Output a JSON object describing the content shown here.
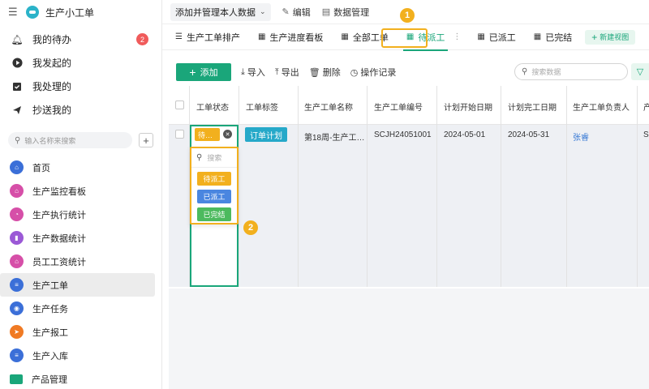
{
  "app": {
    "title": "生产小工单"
  },
  "top_nav": [
    {
      "label": "我的待办",
      "icon": "bell-icon",
      "badge": "2"
    },
    {
      "label": "我发起的",
      "icon": "play-icon"
    },
    {
      "label": "我处理的",
      "icon": "inbox-icon"
    },
    {
      "label": "抄送我的",
      "icon": "send-icon"
    }
  ],
  "sidebar_search": {
    "placeholder": "输入名称来搜索"
  },
  "nav": [
    {
      "label": "首页",
      "icon": "home-icon",
      "color": "#3b6fd8"
    },
    {
      "label": "生产监控看板",
      "icon": "home-icon",
      "color": "#d64fa8"
    },
    {
      "label": "生产执行统计",
      "icon": "pie-chart-icon",
      "color": "#d64fa8"
    },
    {
      "label": "生产数据统计",
      "icon": "bar-chart-icon",
      "color": "#9b59d6"
    },
    {
      "label": "员工工资统计",
      "icon": "home-icon",
      "color": "#d64fa8"
    },
    {
      "label": "生产工单",
      "icon": "document-icon",
      "color": "#3b6fd8"
    },
    {
      "label": "生产任务",
      "icon": "target-icon",
      "color": "#3b6fd8"
    },
    {
      "label": "生产报工",
      "icon": "send-icon",
      "color": "#f07a24"
    },
    {
      "label": "生产入库",
      "icon": "document-icon",
      "color": "#3b6fd8"
    },
    {
      "label": "产品管理",
      "icon": "folder-icon",
      "color": "#1aa67a"
    }
  ],
  "toolbar": {
    "view_select": "添加并管理本人数据",
    "edit": "编辑",
    "data_manage": "数据管理"
  },
  "tabs": [
    {
      "label": "生产工单排产",
      "icon": "gantt-icon"
    },
    {
      "label": "生产进度看板",
      "icon": "table-icon"
    },
    {
      "label": "全部工单",
      "icon": "table-icon"
    },
    {
      "label": "待派工",
      "icon": "table-icon",
      "active": true
    },
    {
      "label": "已派工",
      "icon": "table-icon"
    },
    {
      "label": "已完结",
      "icon": "table-icon"
    }
  ],
  "new_view": "新建视图",
  "markers": {
    "one": "1",
    "two": "2"
  },
  "actions": {
    "add": "添加",
    "import": "导入",
    "export": "导出",
    "delete": "删除",
    "log": "操作记录",
    "search_placeholder": "搜索数据"
  },
  "columns": [
    "工单状态",
    "工单标签",
    "生产工单名称",
    "生产工单编号",
    "计划开始日期",
    "计划完工日期",
    "生产工单负责人",
    "产"
  ],
  "row": {
    "status": "待…",
    "tag": "订单计划",
    "name": "第18周-生产工…",
    "code": "SCJH24051001",
    "start": "2024-05-01",
    "end": "2024-05-31",
    "owner": "张睿",
    "extra": "S"
  },
  "dropdown": {
    "search_placeholder": "搜索",
    "options": [
      {
        "label": "待派工",
        "color": "#f2b01e"
      },
      {
        "label": "已派工",
        "color": "#4a86e0"
      },
      {
        "label": "已完结",
        "color": "#4cba5e"
      }
    ]
  }
}
